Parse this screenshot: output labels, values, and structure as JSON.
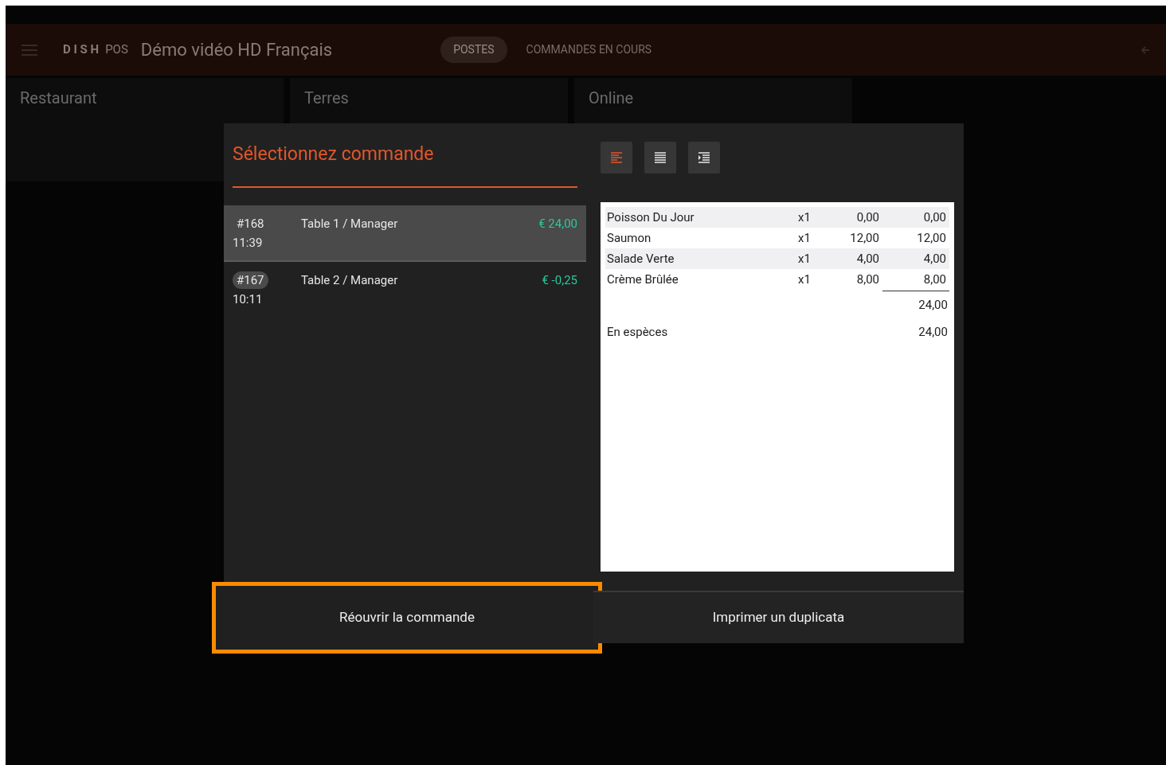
{
  "app_bar": {
    "logo": "D I S H",
    "logo_suffix": "POS",
    "title": "Démo vidéo HD Français",
    "tabs": [
      {
        "label": "POSTES",
        "selected": true
      },
      {
        "label": "COMMANDES EN COURS",
        "selected": false
      }
    ]
  },
  "areas": [
    "Restaurant",
    "Terres",
    "Online"
  ],
  "dialog": {
    "title": "Sélectionnez commande",
    "orders": [
      {
        "number": "#168",
        "time": "11:39",
        "table": "Table 1 / Manager",
        "amount": "€ 24,00",
        "selected": true
      },
      {
        "number": "#167",
        "time": "10:11",
        "table": "Table 2 / Manager",
        "amount": "€ -0,25",
        "selected": false
      }
    ],
    "view_buttons": [
      {
        "kind": "left",
        "selected": true
      },
      {
        "kind": "full",
        "selected": false
      },
      {
        "kind": "indent",
        "selected": false
      }
    ],
    "receipt": {
      "lines": [
        {
          "item": "Poisson Du Jour",
          "qty": "x1",
          "price": "0,00",
          "total": "0,00"
        },
        {
          "item": "Saumon",
          "qty": "x1",
          "price": "12,00",
          "total": "12,00"
        },
        {
          "item": "Salade Verte",
          "qty": "x1",
          "price": "4,00",
          "total": "4,00"
        },
        {
          "item": "Crème Brûlée",
          "qty": "x1",
          "price": "8,00",
          "total": "8,00"
        }
      ],
      "sum": "24,00",
      "payment": {
        "label": "En espèces",
        "amount": "24,00"
      }
    },
    "actions": [
      {
        "label": "Réouvrir la commande",
        "highlighted": true
      },
      {
        "label": "Imprimer un duplicata",
        "highlighted": false
      }
    ]
  }
}
